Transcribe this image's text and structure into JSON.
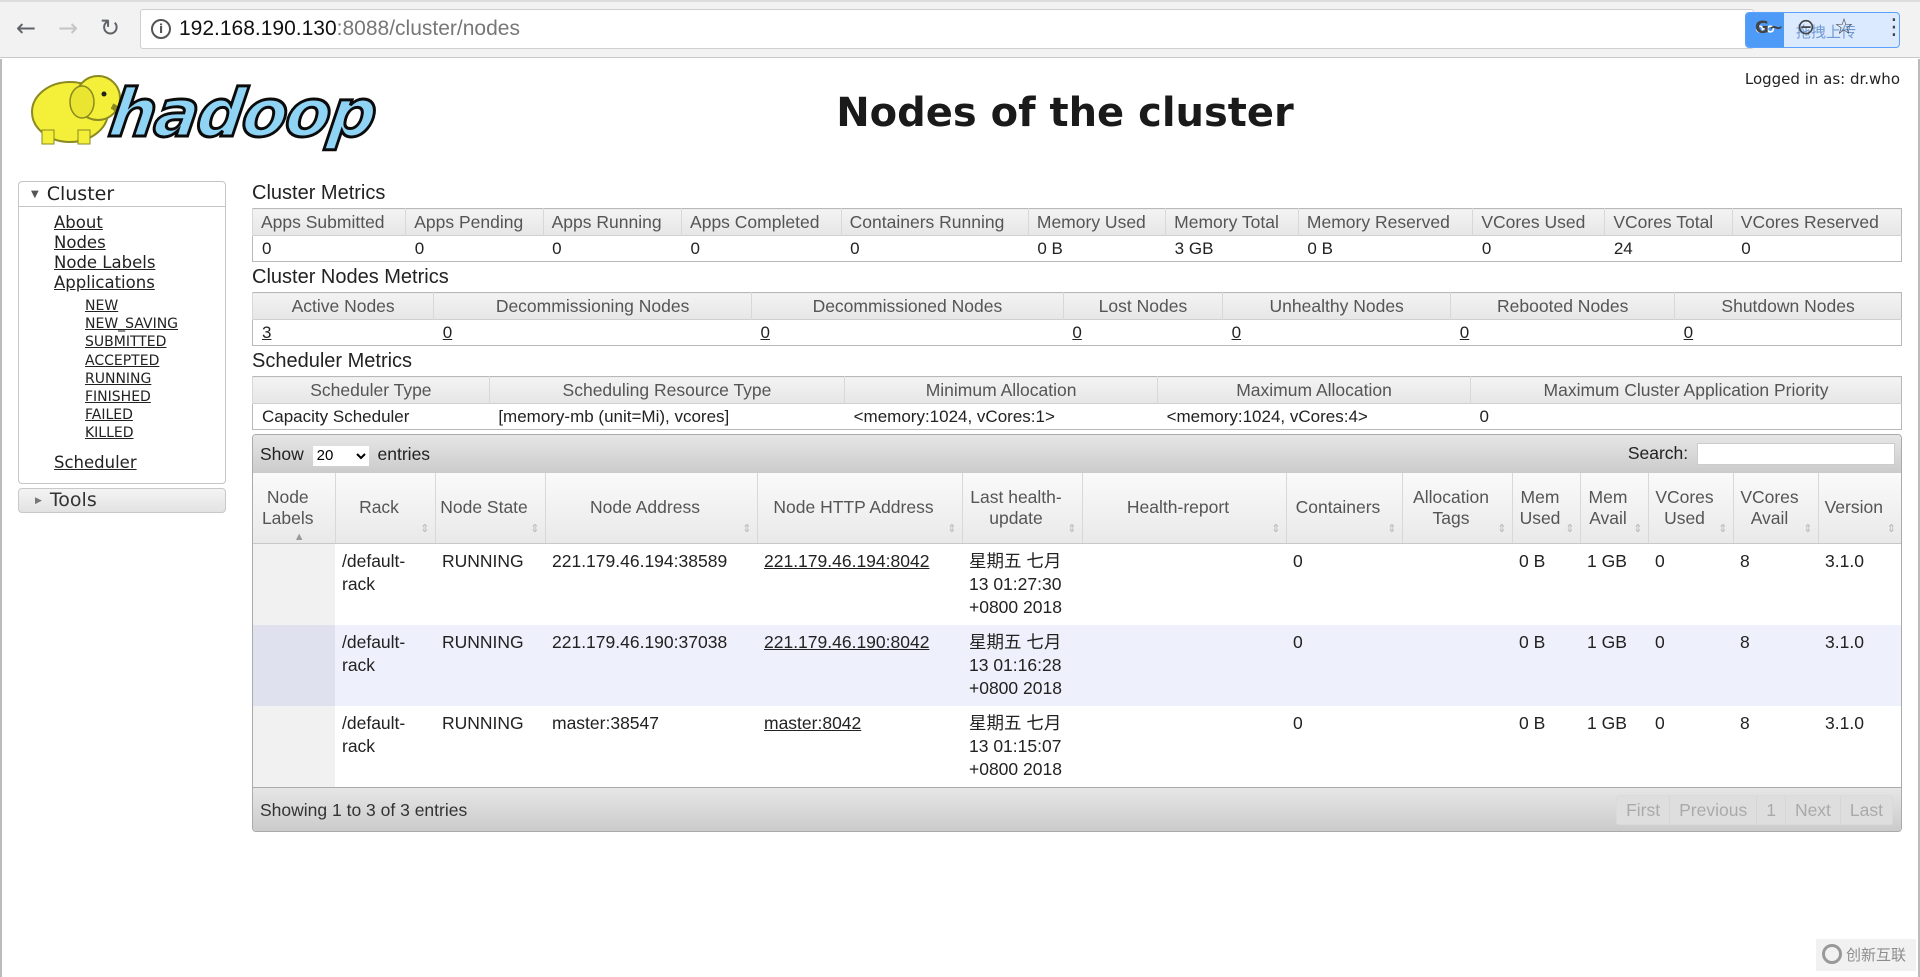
{
  "browser": {
    "url_host": "192.168.190.130",
    "url_rest": ":8088/cluster/nodes",
    "upload_widget_label": "拖拽上传",
    "icons": [
      "back-arrow-icon",
      "forward-arrow-icon",
      "reload-icon",
      "info-icon",
      "translate-icon",
      "zoom-out-icon",
      "bookmark-star-icon",
      "menu-kebab-icon"
    ]
  },
  "header": {
    "logo_text": "hadoop",
    "title": "Nodes of the cluster",
    "logged_in": "Logged in as: dr.who"
  },
  "sidebar": {
    "cluster_label": "Cluster",
    "links": [
      "About",
      "Nodes",
      "Node Labels",
      "Applications"
    ],
    "app_states": [
      "NEW",
      "NEW_SAVING",
      "SUBMITTED",
      "ACCEPTED",
      "RUNNING",
      "FINISHED",
      "FAILED",
      "KILLED"
    ],
    "scheduler": "Scheduler",
    "tools_label": "Tools"
  },
  "cluster_metrics": {
    "title": "Cluster Metrics",
    "headers": [
      "Apps Submitted",
      "Apps Pending",
      "Apps Running",
      "Apps Completed",
      "Containers Running",
      "Memory Used",
      "Memory Total",
      "Memory Reserved",
      "VCores Used",
      "VCores Total",
      "VCores Reserved"
    ],
    "values": [
      "0",
      "0",
      "0",
      "0",
      "0",
      "0 B",
      "3 GB",
      "0 B",
      "0",
      "24",
      "0"
    ]
  },
  "node_metrics": {
    "title": "Cluster Nodes Metrics",
    "headers": [
      "Active Nodes",
      "Decommissioning Nodes",
      "Decommissioned Nodes",
      "Lost Nodes",
      "Unhealthy Nodes",
      "Rebooted Nodes",
      "Shutdown Nodes"
    ],
    "values": [
      "3",
      "0",
      "0",
      "0",
      "0",
      "0",
      "0"
    ]
  },
  "scheduler_metrics": {
    "title": "Scheduler Metrics",
    "headers": [
      "Scheduler Type",
      "Scheduling Resource Type",
      "Minimum Allocation",
      "Maximum Allocation",
      "Maximum Cluster Application Priority"
    ],
    "values": [
      "Capacity Scheduler",
      "[memory-mb (unit=Mi), vcores]",
      "<memory:1024, vCores:1>",
      "<memory:1024, vCores:4>",
      "0"
    ]
  },
  "nodes_table": {
    "show_label": "Show",
    "entries_label": "entries",
    "page_length": "20",
    "search_label": "Search:",
    "search_value": "",
    "headers": [
      "Node Labels",
      "Rack",
      "Node State",
      "Node Address",
      "Node HTTP Address",
      "Last health-update",
      "Health-report",
      "Containers",
      "Allocation Tags",
      "Mem Used",
      "Mem Avail",
      "VCores Used",
      "VCores Avail",
      "Version"
    ],
    "rows": [
      {
        "labels": "",
        "rack": "/default-rack",
        "state": "RUNNING",
        "address": "221.179.46.194:38589",
        "http": "221.179.46.194:8042",
        "health_update": "星期五 七月 13 01:27:30 +0800 2018",
        "health_report": "",
        "containers": "0",
        "tags": "",
        "mem_used": "0 B",
        "mem_avail": "1 GB",
        "vcores_used": "0",
        "vcores_avail": "8",
        "version": "3.1.0"
      },
      {
        "labels": "",
        "rack": "/default-rack",
        "state": "RUNNING",
        "address": "221.179.46.190:37038",
        "http": "221.179.46.190:8042",
        "health_update": "星期五 七月 13 01:16:28 +0800 2018",
        "health_report": "",
        "containers": "0",
        "tags": "",
        "mem_used": "0 B",
        "mem_avail": "1 GB",
        "vcores_used": "0",
        "vcores_avail": "8",
        "version": "3.1.0"
      },
      {
        "labels": "",
        "rack": "/default-rack",
        "state": "RUNNING",
        "address": "master:38547",
        "http": "master:8042",
        "health_update": "星期五 七月 13 01:15:07 +0800 2018",
        "health_report": "",
        "containers": "0",
        "tags": "",
        "mem_used": "0 B",
        "mem_avail": "1 GB",
        "vcores_used": "0",
        "vcores_avail": "8",
        "version": "3.1.0"
      }
    ],
    "info": "Showing 1 to 3 of 3 entries",
    "pager": [
      "First",
      "Previous",
      "1",
      "Next",
      "Last"
    ]
  },
  "watermark": "创新互联"
}
